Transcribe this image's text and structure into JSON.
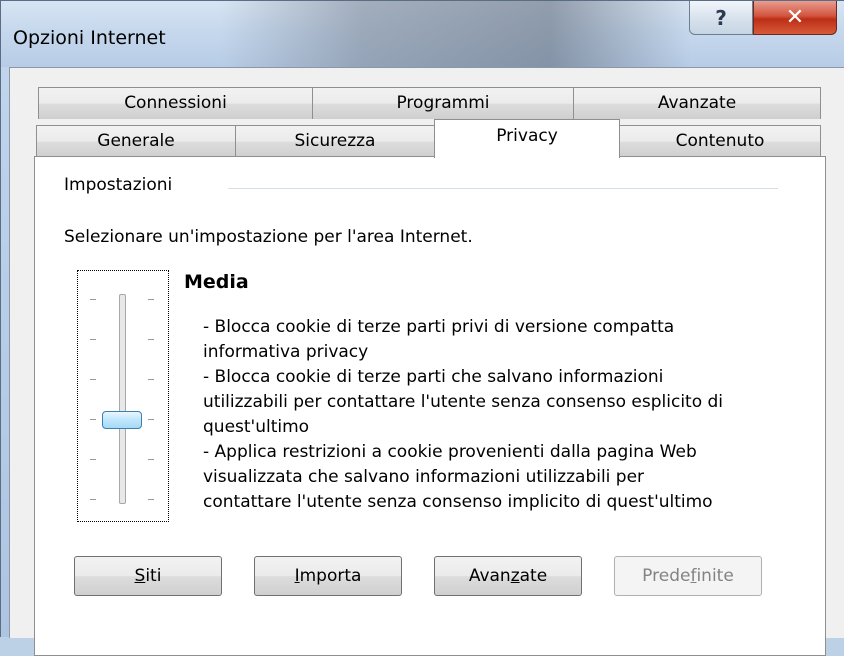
{
  "window": {
    "title": "Opzioni Internet",
    "help_glyph": "?",
    "close_glyph": "✕"
  },
  "tabs_row1": [
    "Connessioni",
    "Programmi",
    "Avanzate"
  ],
  "tabs_row2": [
    "Generale",
    "Sicurezza",
    "Privacy",
    "Contenuto"
  ],
  "active_tab": "Privacy",
  "settings": {
    "group_label": "Impostazioni",
    "instruction": "Selezionare un'impostazione per l'area Internet.",
    "level_name": "Media",
    "level_description": [
      "- Blocca cookie di terze parti privi di versione compatta",
      "informativa privacy",
      "- Blocca cookie di terze parti che salvano informazioni",
      "utilizzabili per contattare l'utente senza consenso esplicito di",
      "quest'ultimo",
      "- Applica restrizioni a cookie provenienti dalla pagina Web",
      "visualizzata che salvano informazioni utilizzabili per",
      "contattare l'utente senza consenso implicito di quest'ultimo"
    ],
    "slider_position_fraction_from_top": 0.6
  },
  "buttons": {
    "siti": {
      "before": "",
      "accel": "S",
      "after": "iti"
    },
    "importa": {
      "before": "",
      "accel": "I",
      "after": "mporta"
    },
    "avanzate": {
      "before": "Avan",
      "accel": "z",
      "after": "ate"
    },
    "predefinite": {
      "before": "Prede",
      "accel": "f",
      "after": "inite"
    }
  }
}
